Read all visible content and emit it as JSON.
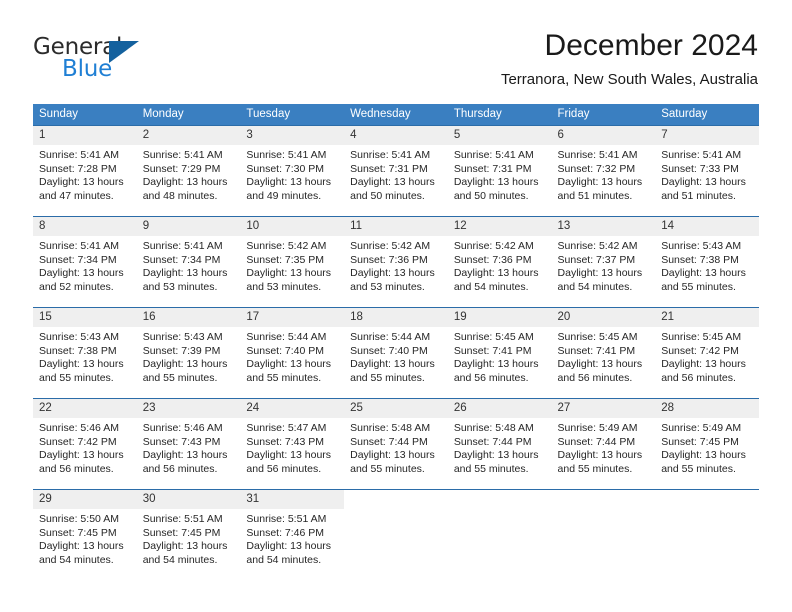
{
  "brand": {
    "line1": "General",
    "line2": "Blue",
    "triangle_color": "#14619e",
    "blue_text_color": "#1f7fd4"
  },
  "header": {
    "month_title": "December 2024",
    "location": "Terranora, New South Wales, Australia"
  },
  "colors": {
    "header_blue": "#3a7fc1",
    "row_rule_blue": "#2b6ca8",
    "daynum_band": "#efefef",
    "text": "#262626"
  },
  "weekday_headers": [
    "Sunday",
    "Monday",
    "Tuesday",
    "Wednesday",
    "Thursday",
    "Friday",
    "Saturday"
  ],
  "weeks": [
    [
      {
        "day": "1",
        "sunrise": "Sunrise: 5:41 AM",
        "sunset": "Sunset: 7:28 PM",
        "daylight1": "Daylight: 13 hours",
        "daylight2": "and 47 minutes."
      },
      {
        "day": "2",
        "sunrise": "Sunrise: 5:41 AM",
        "sunset": "Sunset: 7:29 PM",
        "daylight1": "Daylight: 13 hours",
        "daylight2": "and 48 minutes."
      },
      {
        "day": "3",
        "sunrise": "Sunrise: 5:41 AM",
        "sunset": "Sunset: 7:30 PM",
        "daylight1": "Daylight: 13 hours",
        "daylight2": "and 49 minutes."
      },
      {
        "day": "4",
        "sunrise": "Sunrise: 5:41 AM",
        "sunset": "Sunset: 7:31 PM",
        "daylight1": "Daylight: 13 hours",
        "daylight2": "and 50 minutes."
      },
      {
        "day": "5",
        "sunrise": "Sunrise: 5:41 AM",
        "sunset": "Sunset: 7:31 PM",
        "daylight1": "Daylight: 13 hours",
        "daylight2": "and 50 minutes."
      },
      {
        "day": "6",
        "sunrise": "Sunrise: 5:41 AM",
        "sunset": "Sunset: 7:32 PM",
        "daylight1": "Daylight: 13 hours",
        "daylight2": "and 51 minutes."
      },
      {
        "day": "7",
        "sunrise": "Sunrise: 5:41 AM",
        "sunset": "Sunset: 7:33 PM",
        "daylight1": "Daylight: 13 hours",
        "daylight2": "and 51 minutes."
      }
    ],
    [
      {
        "day": "8",
        "sunrise": "Sunrise: 5:41 AM",
        "sunset": "Sunset: 7:34 PM",
        "daylight1": "Daylight: 13 hours",
        "daylight2": "and 52 minutes."
      },
      {
        "day": "9",
        "sunrise": "Sunrise: 5:41 AM",
        "sunset": "Sunset: 7:34 PM",
        "daylight1": "Daylight: 13 hours",
        "daylight2": "and 53 minutes."
      },
      {
        "day": "10",
        "sunrise": "Sunrise: 5:42 AM",
        "sunset": "Sunset: 7:35 PM",
        "daylight1": "Daylight: 13 hours",
        "daylight2": "and 53 minutes."
      },
      {
        "day": "11",
        "sunrise": "Sunrise: 5:42 AM",
        "sunset": "Sunset: 7:36 PM",
        "daylight1": "Daylight: 13 hours",
        "daylight2": "and 53 minutes."
      },
      {
        "day": "12",
        "sunrise": "Sunrise: 5:42 AM",
        "sunset": "Sunset: 7:36 PM",
        "daylight1": "Daylight: 13 hours",
        "daylight2": "and 54 minutes."
      },
      {
        "day": "13",
        "sunrise": "Sunrise: 5:42 AM",
        "sunset": "Sunset: 7:37 PM",
        "daylight1": "Daylight: 13 hours",
        "daylight2": "and 54 minutes."
      },
      {
        "day": "14",
        "sunrise": "Sunrise: 5:43 AM",
        "sunset": "Sunset: 7:38 PM",
        "daylight1": "Daylight: 13 hours",
        "daylight2": "and 55 minutes."
      }
    ],
    [
      {
        "day": "15",
        "sunrise": "Sunrise: 5:43 AM",
        "sunset": "Sunset: 7:38 PM",
        "daylight1": "Daylight: 13 hours",
        "daylight2": "and 55 minutes."
      },
      {
        "day": "16",
        "sunrise": "Sunrise: 5:43 AM",
        "sunset": "Sunset: 7:39 PM",
        "daylight1": "Daylight: 13 hours",
        "daylight2": "and 55 minutes."
      },
      {
        "day": "17",
        "sunrise": "Sunrise: 5:44 AM",
        "sunset": "Sunset: 7:40 PM",
        "daylight1": "Daylight: 13 hours",
        "daylight2": "and 55 minutes."
      },
      {
        "day": "18",
        "sunrise": "Sunrise: 5:44 AM",
        "sunset": "Sunset: 7:40 PM",
        "daylight1": "Daylight: 13 hours",
        "daylight2": "and 55 minutes."
      },
      {
        "day": "19",
        "sunrise": "Sunrise: 5:45 AM",
        "sunset": "Sunset: 7:41 PM",
        "daylight1": "Daylight: 13 hours",
        "daylight2": "and 56 minutes."
      },
      {
        "day": "20",
        "sunrise": "Sunrise: 5:45 AM",
        "sunset": "Sunset: 7:41 PM",
        "daylight1": "Daylight: 13 hours",
        "daylight2": "and 56 minutes."
      },
      {
        "day": "21",
        "sunrise": "Sunrise: 5:45 AM",
        "sunset": "Sunset: 7:42 PM",
        "daylight1": "Daylight: 13 hours",
        "daylight2": "and 56 minutes."
      }
    ],
    [
      {
        "day": "22",
        "sunrise": "Sunrise: 5:46 AM",
        "sunset": "Sunset: 7:42 PM",
        "daylight1": "Daylight: 13 hours",
        "daylight2": "and 56 minutes."
      },
      {
        "day": "23",
        "sunrise": "Sunrise: 5:46 AM",
        "sunset": "Sunset: 7:43 PM",
        "daylight1": "Daylight: 13 hours",
        "daylight2": "and 56 minutes."
      },
      {
        "day": "24",
        "sunrise": "Sunrise: 5:47 AM",
        "sunset": "Sunset: 7:43 PM",
        "daylight1": "Daylight: 13 hours",
        "daylight2": "and 56 minutes."
      },
      {
        "day": "25",
        "sunrise": "Sunrise: 5:48 AM",
        "sunset": "Sunset: 7:44 PM",
        "daylight1": "Daylight: 13 hours",
        "daylight2": "and 55 minutes."
      },
      {
        "day": "26",
        "sunrise": "Sunrise: 5:48 AM",
        "sunset": "Sunset: 7:44 PM",
        "daylight1": "Daylight: 13 hours",
        "daylight2": "and 55 minutes."
      },
      {
        "day": "27",
        "sunrise": "Sunrise: 5:49 AM",
        "sunset": "Sunset: 7:44 PM",
        "daylight1": "Daylight: 13 hours",
        "daylight2": "and 55 minutes."
      },
      {
        "day": "28",
        "sunrise": "Sunrise: 5:49 AM",
        "sunset": "Sunset: 7:45 PM",
        "daylight1": "Daylight: 13 hours",
        "daylight2": "and 55 minutes."
      }
    ],
    [
      {
        "day": "29",
        "sunrise": "Sunrise: 5:50 AM",
        "sunset": "Sunset: 7:45 PM",
        "daylight1": "Daylight: 13 hours",
        "daylight2": "and 54 minutes."
      },
      {
        "day": "30",
        "sunrise": "Sunrise: 5:51 AM",
        "sunset": "Sunset: 7:45 PM",
        "daylight1": "Daylight: 13 hours",
        "daylight2": "and 54 minutes."
      },
      {
        "day": "31",
        "sunrise": "Sunrise: 5:51 AM",
        "sunset": "Sunset: 7:46 PM",
        "daylight1": "Daylight: 13 hours",
        "daylight2": "and 54 minutes."
      },
      {
        "day": "",
        "sunrise": "",
        "sunset": "",
        "daylight1": "",
        "daylight2": ""
      },
      {
        "day": "",
        "sunrise": "",
        "sunset": "",
        "daylight1": "",
        "daylight2": ""
      },
      {
        "day": "",
        "sunrise": "",
        "sunset": "",
        "daylight1": "",
        "daylight2": ""
      },
      {
        "day": "",
        "sunrise": "",
        "sunset": "",
        "daylight1": "",
        "daylight2": ""
      }
    ]
  ]
}
